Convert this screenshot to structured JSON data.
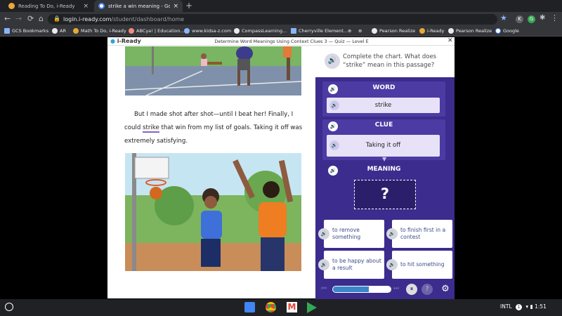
{
  "browser": {
    "tabs": [
      {
        "title": "Reading To Do, i-Ready",
        "active": false
      },
      {
        "title": "strike a win meaning - Google S",
        "active": true
      }
    ],
    "new_tab": "+",
    "url_host": "login.i-ready.com",
    "url_path": "/student/dashboard/home",
    "nav": {
      "back": "←",
      "forward": "→",
      "reload": "⟳",
      "home": "⌂",
      "star": "★"
    },
    "extensions": [
      "K",
      "G"
    ],
    "menu": "⋮",
    "bookmarks": [
      "GCS Bookmarks",
      "AR",
      "Math To Do, i-Ready",
      "ABCya! | Education...",
      "www.kidsa-z.com",
      "CompassLearning...",
      "Cherryville Element...",
      "Pearson Realize",
      "i-Ready",
      "Pearson Realize",
      "Google"
    ],
    "bookmark_extra": [
      "⊕",
      "⊕"
    ]
  },
  "app": {
    "logo": "i-Ready",
    "title": "Determine Word Meanings Using Context Clues 3 — Quiz — Level E",
    "close": "✕"
  },
  "passage": {
    "before": "But I made shot after shot—until I beat her! Finally, I could ",
    "word": "strike",
    "after": " that win from my list of goals. Taking it off was extremely satisfying."
  },
  "question": {
    "prompt": "Complete the chart. What does “strike” mean in this passage?"
  },
  "chart": {
    "word_header": "WORD",
    "word_value": "strike",
    "clue_header": "CLUE",
    "clue_value": "Taking it off",
    "meaning_header": "MEANING",
    "meaning_placeholder": "?"
  },
  "choices": [
    "to remove something",
    "to finish first in a contest",
    "to be happy about a result",
    "to hit something"
  ],
  "controls": {
    "progress": 0.62,
    "pause": "⏸",
    "help": "?",
    "settings": "⚙"
  },
  "shelf": {
    "locale": "INTL",
    "indicator": "1",
    "time": "1:51",
    "apps": [
      "docs",
      "chrome",
      "gmail",
      "play"
    ]
  },
  "colors": {
    "panel": "#3c2c8d",
    "section": "#4b3ba3",
    "answer": "#e7e2f7",
    "accent": "#8066c6"
  }
}
